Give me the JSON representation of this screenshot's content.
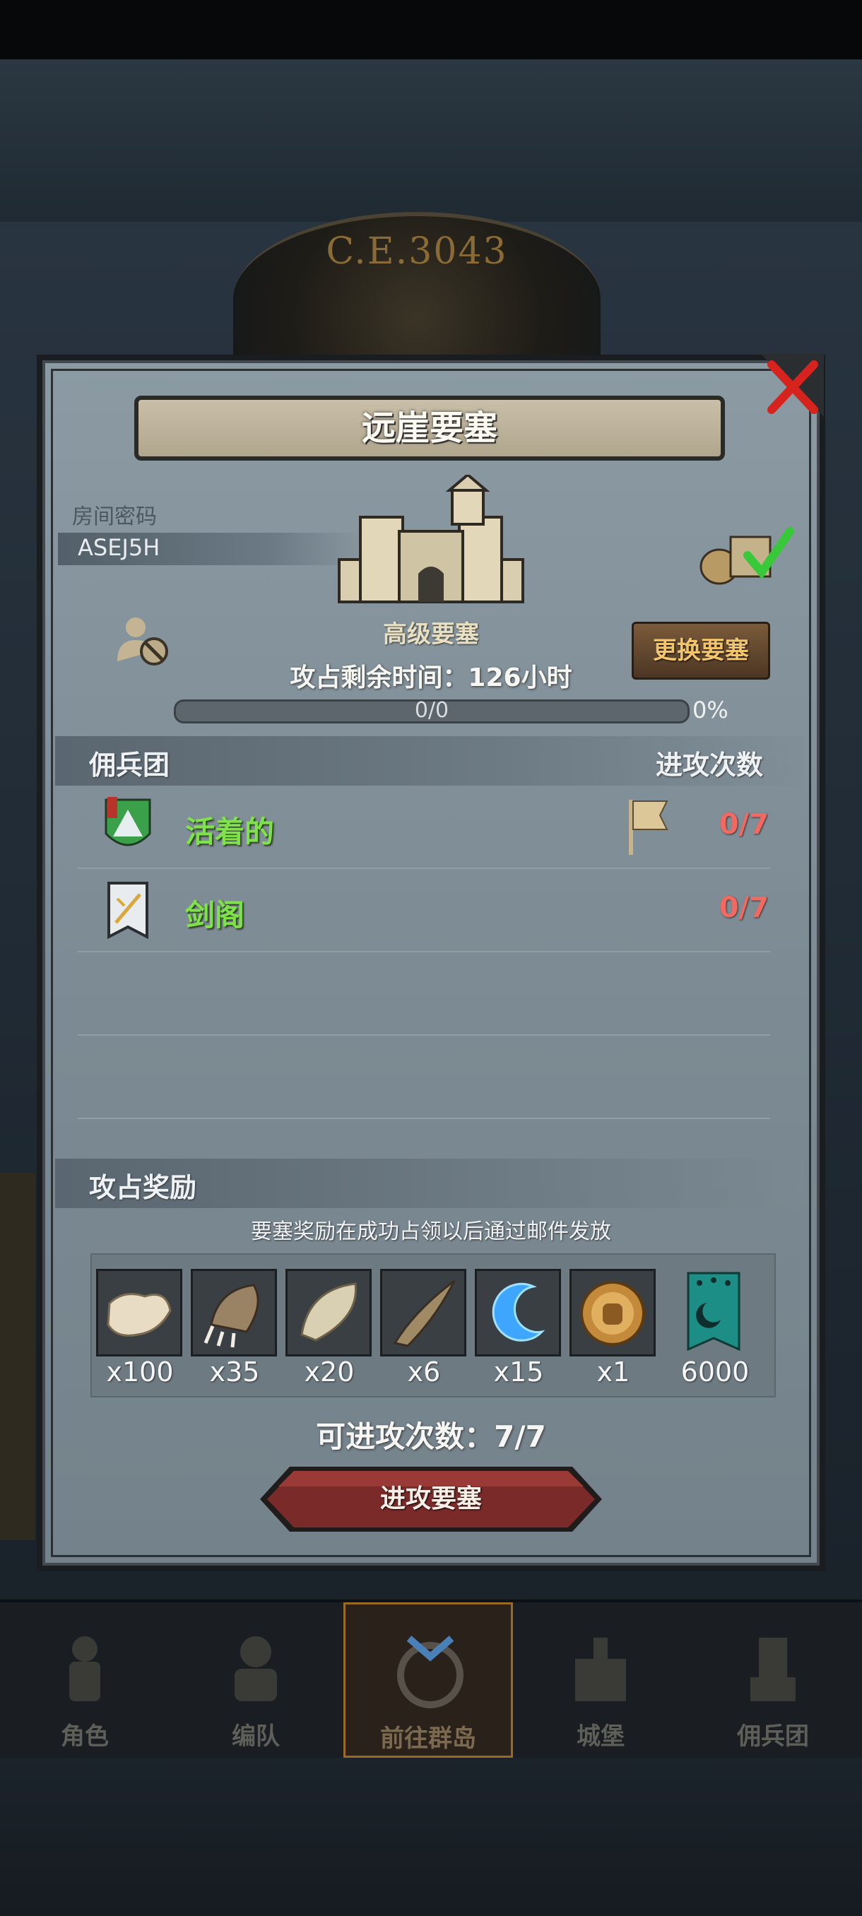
{
  "background": {
    "year": "C.E.3043"
  },
  "dialog": {
    "title": "远崖要塞",
    "room_label": "房间密码",
    "room_code": "ASEJ5H",
    "fortress_level": "高级要塞",
    "change_button": "更换要塞",
    "time_left": "攻占剩余时间：126小时",
    "progress_text": "0/0",
    "progress_percent": "0%",
    "progress_value": 0
  },
  "mercenary_section": {
    "title": "佣兵团",
    "column_attacks": "进攻次数",
    "rows": [
      {
        "name": "活着的",
        "count": "0/7",
        "has_flag": true
      },
      {
        "name": "剑阁",
        "count": "0/7",
        "has_flag": false
      }
    ]
  },
  "reward_section": {
    "title": "攻占奖励",
    "note": "要塞奖励在成功占领以后通过邮件发放",
    "items": [
      {
        "icon": "fur-pelt-icon",
        "qty": "x100"
      },
      {
        "icon": "beast-claw-icon",
        "qty": "x35"
      },
      {
        "icon": "feather-icon",
        "qty": "x20"
      },
      {
        "icon": "horn-icon",
        "qty": "x6"
      },
      {
        "icon": "blue-crescent-icon",
        "qty": "x15"
      },
      {
        "icon": "knight-medal-icon",
        "qty": "x1"
      },
      {
        "icon": "guild-banner-icon",
        "qty": "6000"
      }
    ]
  },
  "attack": {
    "attacks_left": "可进攻次数：7/7",
    "button": "进攻要塞"
  },
  "bottom_nav": [
    {
      "label": "角色",
      "active": false
    },
    {
      "label": "编队",
      "active": false
    },
    {
      "label": "前往群岛",
      "active": true
    },
    {
      "label": "城堡",
      "active": false
    },
    {
      "label": "佣兵团",
      "active": false
    }
  ],
  "colors": {
    "green_name": "#7fe24a",
    "red_count": "#f06a62",
    "button_red": "#7a2a28",
    "accent_orange": "#f2c56a"
  }
}
